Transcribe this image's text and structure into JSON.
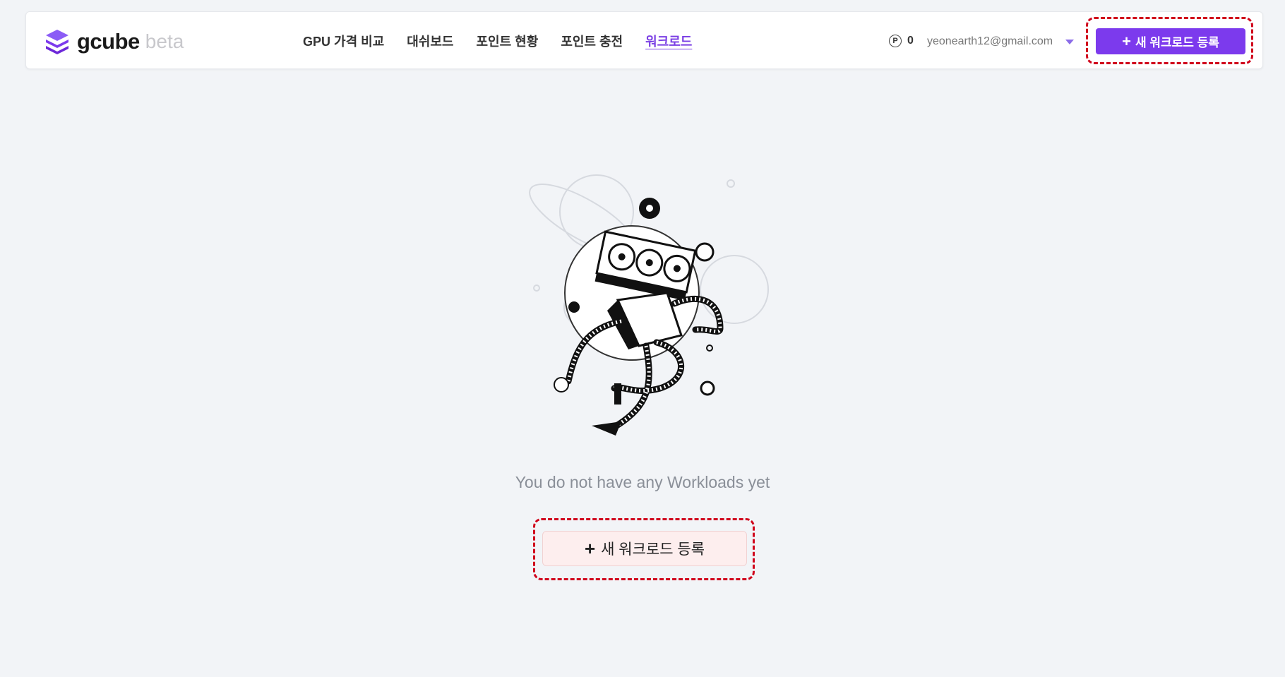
{
  "brand": {
    "name": "gcube",
    "tag": "beta",
    "color": "#7c3aed"
  },
  "nav": {
    "items": [
      {
        "label": "GPU 가격 비교"
      },
      {
        "label": "대쉬보드"
      },
      {
        "label": "포인트 현황"
      },
      {
        "label": "포인트 충전"
      },
      {
        "label": "워크로드",
        "active": true
      }
    ]
  },
  "account": {
    "points": "0",
    "point_symbol": "P",
    "email": "yeonearth12@gmail.com"
  },
  "header_button": {
    "label": "새 워크로드 등록",
    "icon": "plus-icon"
  },
  "empty_state": {
    "message": "You do not have any Workloads yet",
    "button_label": "새 워크로드 등록",
    "illustration": "robot-gpu-space-illustration"
  },
  "highlight_color": "#d0021b"
}
